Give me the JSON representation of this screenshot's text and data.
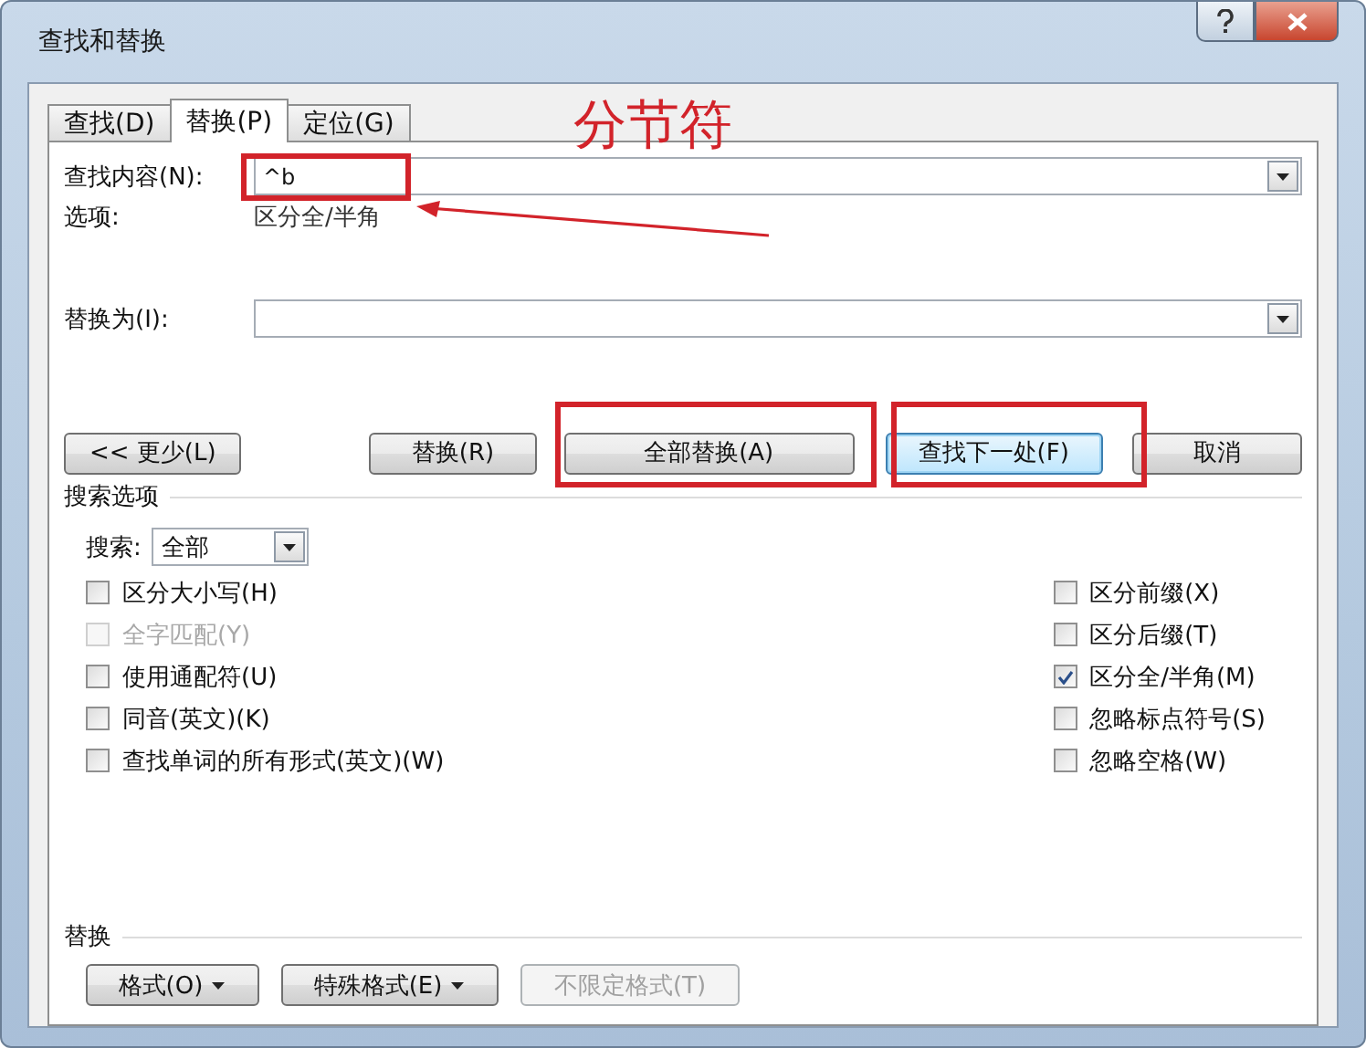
{
  "window": {
    "title": "查找和替换"
  },
  "tabs": [
    {
      "label": "查找(D)",
      "selected": false
    },
    {
      "label": "替换(P)",
      "selected": true
    },
    {
      "label": "定位(G)",
      "selected": false
    }
  ],
  "find": {
    "label": "查找内容(N):",
    "value": "^b",
    "options_label": "选项:",
    "options_value": "区分全/半角"
  },
  "replace": {
    "label": "替换为(I):"
  },
  "buttons": [
    {
      "label": "<< 更少(L)",
      "default": false
    },
    {
      "label": "替换(R)",
      "default": false
    },
    {
      "label": "全部替换(A)",
      "default": false
    },
    {
      "label": "查找下一处(F)",
      "default": true
    },
    {
      "label": "取消",
      "default": false
    }
  ],
  "search_options": {
    "title": "搜索选项",
    "search_label": "搜索:",
    "search_value": "全部"
  },
  "left_checks": [
    {
      "label": "区分大小写(H)",
      "checked": false,
      "disabled": false
    },
    {
      "label": "全字匹配(Y)",
      "checked": false,
      "disabled": true
    },
    {
      "label": "使用通配符(U)",
      "checked": false,
      "disabled": false
    },
    {
      "label": "同音(英文)(K)",
      "checked": false,
      "disabled": false
    },
    {
      "label": "查找单词的所有形式(英文)(W)",
      "checked": false,
      "disabled": false
    }
  ],
  "right_checks": [
    {
      "label": "区分前缀(X)",
      "checked": false,
      "disabled": false
    },
    {
      "label": "区分后缀(T)",
      "checked": false,
      "disabled": false
    },
    {
      "label": "区分全/半角(M)",
      "checked": true,
      "disabled": false
    },
    {
      "label": "忽略标点符号(S)",
      "checked": false,
      "disabled": false
    },
    {
      "label": "忽略空格(W)",
      "checked": false,
      "disabled": false
    }
  ],
  "replace_section": {
    "title": "替换",
    "buttons": [
      {
        "label": "格式(O)",
        "dropdown": true,
        "disabled": false
      },
      {
        "label": "特殊格式(E)",
        "dropdown": true,
        "disabled": false
      },
      {
        "label": "不限定格式(T)",
        "dropdown": false,
        "disabled": true
      }
    ]
  },
  "annotations": [
    {
      "kind": "box"
    },
    {
      "kind": "box"
    },
    {
      "kind": "box"
    },
    {
      "kind": "arrow"
    },
    {
      "kind": "label",
      "text": "分节符"
    }
  ]
}
